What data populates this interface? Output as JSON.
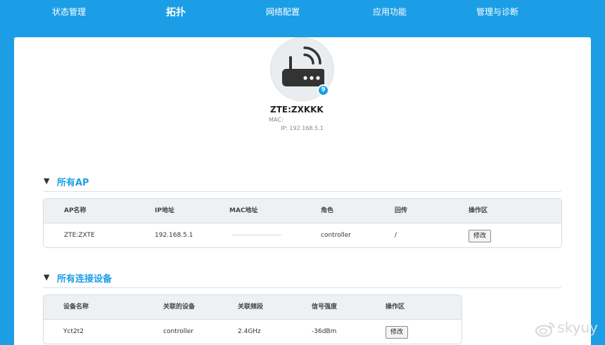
{
  "nav": {
    "items": [
      {
        "label": "状态管理",
        "active": false
      },
      {
        "label": "拓扑",
        "active": true
      },
      {
        "label": "网络配置",
        "active": false
      },
      {
        "label": "应用功能",
        "active": false
      },
      {
        "label": "管理与诊断",
        "active": false
      }
    ]
  },
  "router": {
    "name": "ZTE:ZXKKK",
    "mac": "MAC:",
    "ip": "IP: 192.168.5.1",
    "badge": "9",
    "icon": "router-icon"
  },
  "ap_section": {
    "title": "所有AP",
    "headers": {
      "name": "AP名称",
      "ip": "IP地址",
      "mac": "MAC地址",
      "role": "角色",
      "backhaul": "回传",
      "ops": "操作区"
    },
    "rows": [
      {
        "name": "ZTE:ZXTE",
        "ip": "192.168.5.1",
        "mac": "",
        "role": "controller",
        "backhaul": "/",
        "edit": "修改"
      }
    ]
  },
  "device_section": {
    "title": "所有连接设备",
    "headers": {
      "name": "设备名称",
      "assoc": "关联的设备",
      "band": "关联频段",
      "signal": "信号强度",
      "ops": "操作区"
    },
    "rows": [
      {
        "name": "Yct2t2",
        "assoc": "controller",
        "band": "2.4GHz",
        "signal": "-36dBm",
        "edit": "修改"
      }
    ]
  },
  "watermark": {
    "text": "skyuy",
    "icon": "weibo-icon"
  },
  "colors": {
    "brand": "#1b9ee6",
    "panel": "#ffffff",
    "header_row": "#eef1f4"
  }
}
